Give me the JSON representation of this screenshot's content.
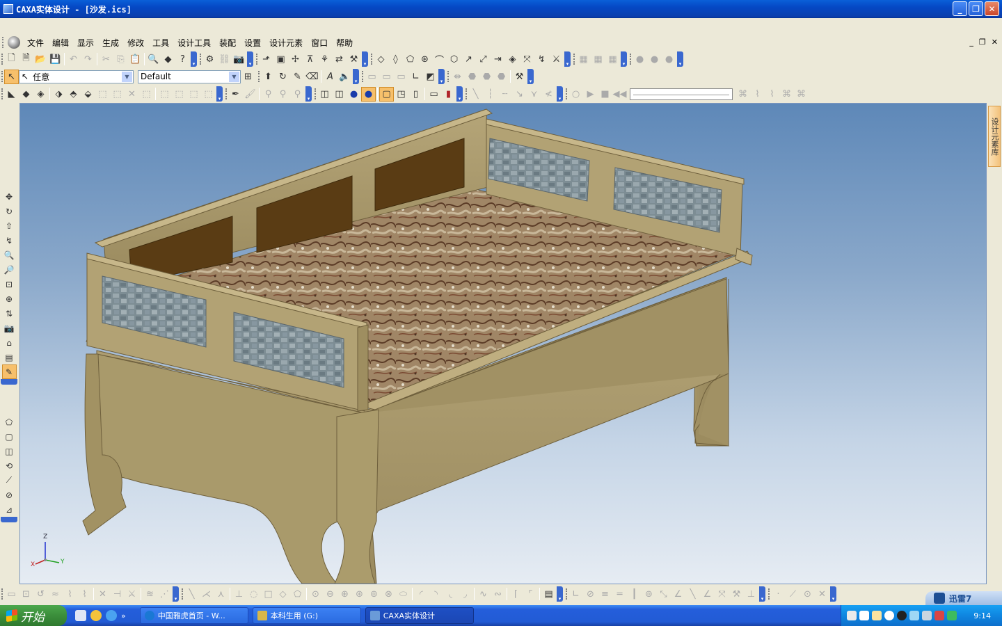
{
  "window": {
    "title": "CAXA实体设计 - [沙发.ics]",
    "buttons": [
      "minimize",
      "restore",
      "close"
    ]
  },
  "menu": {
    "items": [
      "文件",
      "编辑",
      "显示",
      "生成",
      "修改",
      "工具",
      "设计工具",
      "装配",
      "设置",
      "设计元素",
      "窗口",
      "帮助"
    ]
  },
  "toolbar": {
    "selection_filter": "任意",
    "style_combo": "Default"
  },
  "right_panel": {
    "tab_label": "设计元素库"
  },
  "axes": {
    "z": "Z",
    "x": "X",
    "y": "Y"
  },
  "taskbar": {
    "start_label": "开始",
    "tasks": [
      {
        "label": "中国雅虎首页 - W...",
        "icon_color": "#1a78d4"
      },
      {
        "label": "本科生用 (G:)",
        "icon_color": "#d8b74a"
      },
      {
        "label": "CAXA实体设计",
        "icon_color": "#6a9bd8"
      }
    ],
    "clock": "9:14"
  },
  "xunlei": {
    "label": "迅雷7"
  },
  "colors": {
    "wood": "#a89868",
    "wood_dark": "#7a6a44",
    "panel_brown": "#5a3c14",
    "stone": "#7f8f96",
    "cushion": "#9a8060"
  }
}
